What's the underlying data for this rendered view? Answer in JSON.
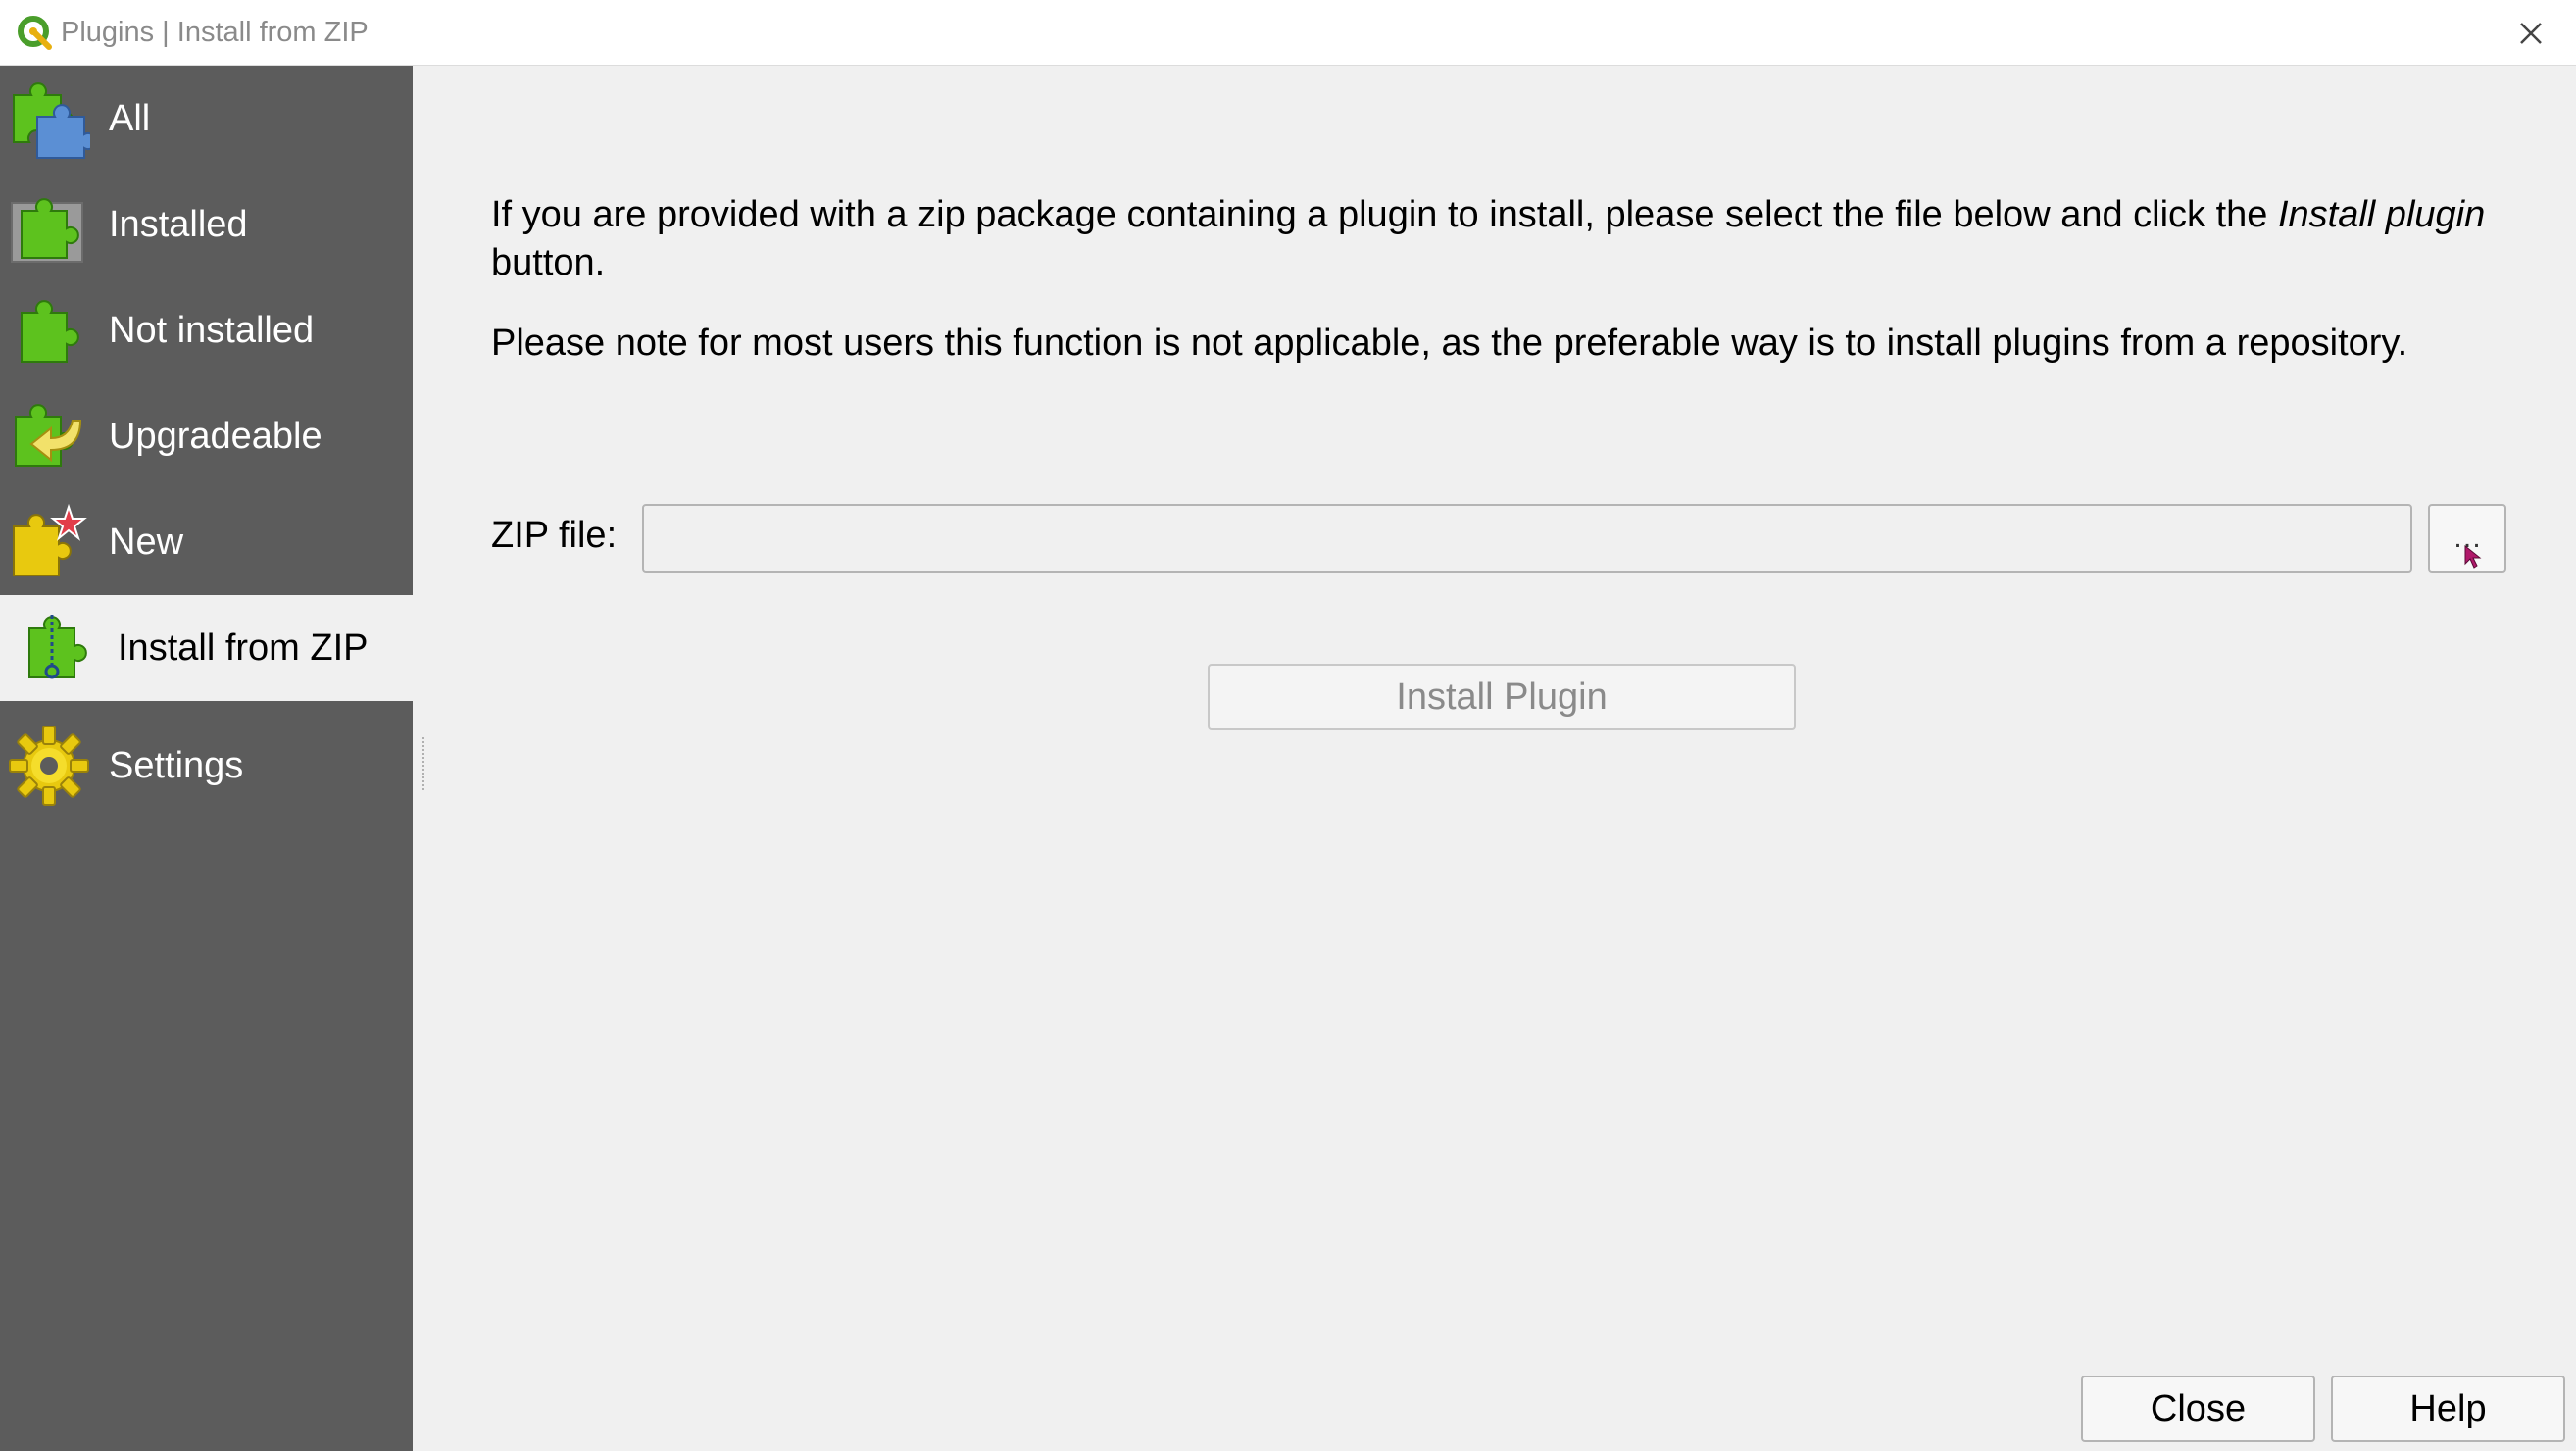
{
  "window": {
    "title": "Plugins | Install from ZIP",
    "close_icon": "close-icon",
    "logo_icon": "qgis-logo-icon"
  },
  "sidebar": {
    "items": [
      {
        "label": "All",
        "icon": "puzzle-all-icon",
        "active": false
      },
      {
        "label": "Installed",
        "icon": "puzzle-installed-icon",
        "active": false
      },
      {
        "label": "Not installed",
        "icon": "puzzle-not-installed-icon",
        "active": false
      },
      {
        "label": "Upgradeable",
        "icon": "puzzle-upgradeable-icon",
        "active": false
      },
      {
        "label": "New",
        "icon": "puzzle-new-icon",
        "active": false
      },
      {
        "label": "Install from ZIP",
        "icon": "puzzle-zip-icon",
        "active": true
      },
      {
        "label": "Settings",
        "icon": "gear-icon",
        "active": false
      }
    ]
  },
  "main": {
    "intro_part1": "If you are provided with a zip package containing a plugin to install, please select the file below and click the ",
    "intro_emphasis": "Install plugin",
    "intro_part2": " button.",
    "note": "Please note for most users this function is not applicable, as the preferable way is to install plugins from a repository.",
    "zip_label": "ZIP file:",
    "zip_value": "",
    "browse_label": "…",
    "install_label": "Install Plugin"
  },
  "footer": {
    "close_label": "Close",
    "help_label": "Help"
  },
  "colors": {
    "sidebar_bg": "#5c5c5c",
    "content_bg": "#f0f0f0",
    "puzzle_green": "#5dc21e",
    "puzzle_yellow": "#e8c90f",
    "puzzle_blue": "#5b8fd4"
  }
}
